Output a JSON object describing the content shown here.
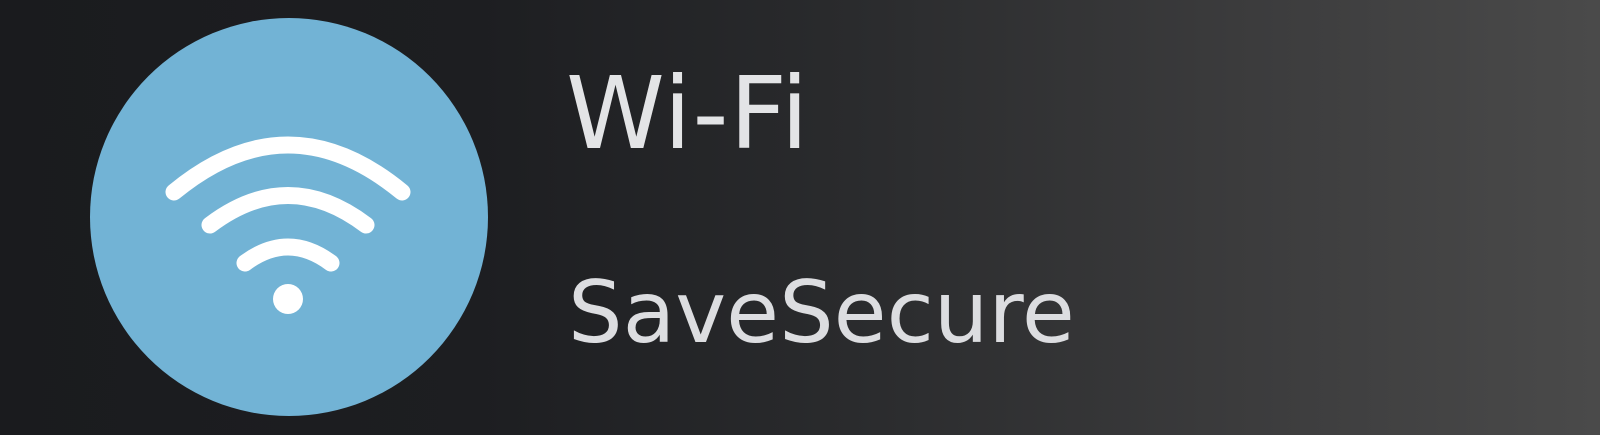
{
  "tile": {
    "title": "Wi-Fi",
    "subtitle": "SaveSecure",
    "icon": "wifi-icon",
    "icon_bg_color": "#72b3d5",
    "text_color": "#e3e4e6"
  }
}
